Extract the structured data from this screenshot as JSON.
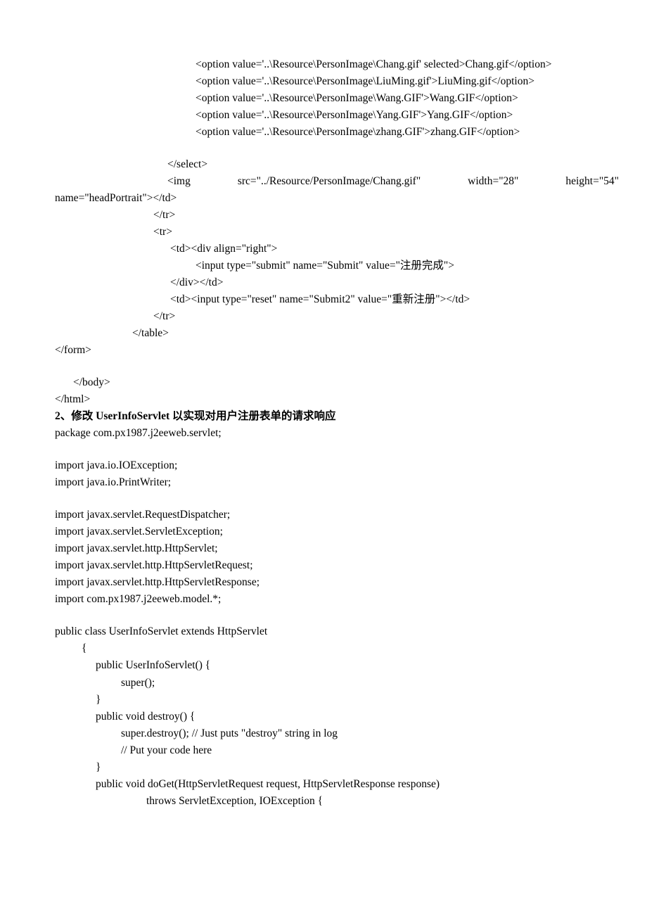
{
  "html_part": {
    "opt1": "<option value='..\\Resource\\PersonImage\\Chang.gif' selected>Chang.gif</option>",
    "opt2": "<option value='..\\Resource\\PersonImage\\LiuMing.gif'>LiuMing.gif</option>",
    "opt3": "<option value='..\\Resource\\PersonImage\\Wang.GIF'>Wang.GIF</option>",
    "opt4": "<option value='..\\Resource\\PersonImage\\Yang.GIF'>Yang.GIF</option>",
    "opt5": "<option value='..\\Resource\\PersonImage\\zhang.GIF'>zhang.GIF</option>",
    "select_end": "</select>",
    "img_a": "<img",
    "img_b": "src=\"../Resource/PersonImage/Chang.gif\"",
    "img_c": "width=\"28\"",
    "img_d": "height=\"54\"",
    "img_close": "name=\"headPortrait\"></td>",
    "tr_close": "</tr>",
    "tr_open": "<tr>",
    "td_div": "<td><div align=\"right\">",
    "input_submit": "<input type=\"submit\" name=\"Submit\" value=\"注册完成\">",
    "div_td_close": "</div></td>",
    "td_reset": "<td><input type=\"reset\" name=\"Submit2\" value=\"重新注册\"></td>",
    "tr_close2": "</tr>",
    "table_close": "</table>",
    "form_close": "</form>",
    "body_close": "</body>",
    "html_close": "</html>"
  },
  "section2_title": "2、修改 UserInfoServlet 以实现对用户注册表单的请求响应",
  "java": {
    "pkg": "package com.px1987.j2eeweb.servlet;",
    "imp1": "import java.io.IOException;",
    "imp2": "import java.io.PrintWriter;",
    "imp3": "import javax.servlet.RequestDispatcher;",
    "imp4": "import javax.servlet.ServletException;",
    "imp5": "import javax.servlet.http.HttpServlet;",
    "imp6": "import javax.servlet.http.HttpServletRequest;",
    "imp7": "import javax.servlet.http.HttpServletResponse;",
    "imp8": "import com.px1987.j2eeweb.model.*;",
    "cls": "public class UserInfoServlet extends HttpServlet",
    "brace_open": "{",
    "ctor": "public UserInfoServlet() {",
    "super": "super();",
    "brace_close": "}",
    "destroy": "public void destroy() {",
    "destroy_body1": "super.destroy(); // Just puts \"destroy\" string in log",
    "destroy_body2": "// Put your code here",
    "doget1": "public void doGet(HttpServletRequest request, HttpServletResponse response)",
    "doget2": "throws ServletException, IOException {"
  }
}
